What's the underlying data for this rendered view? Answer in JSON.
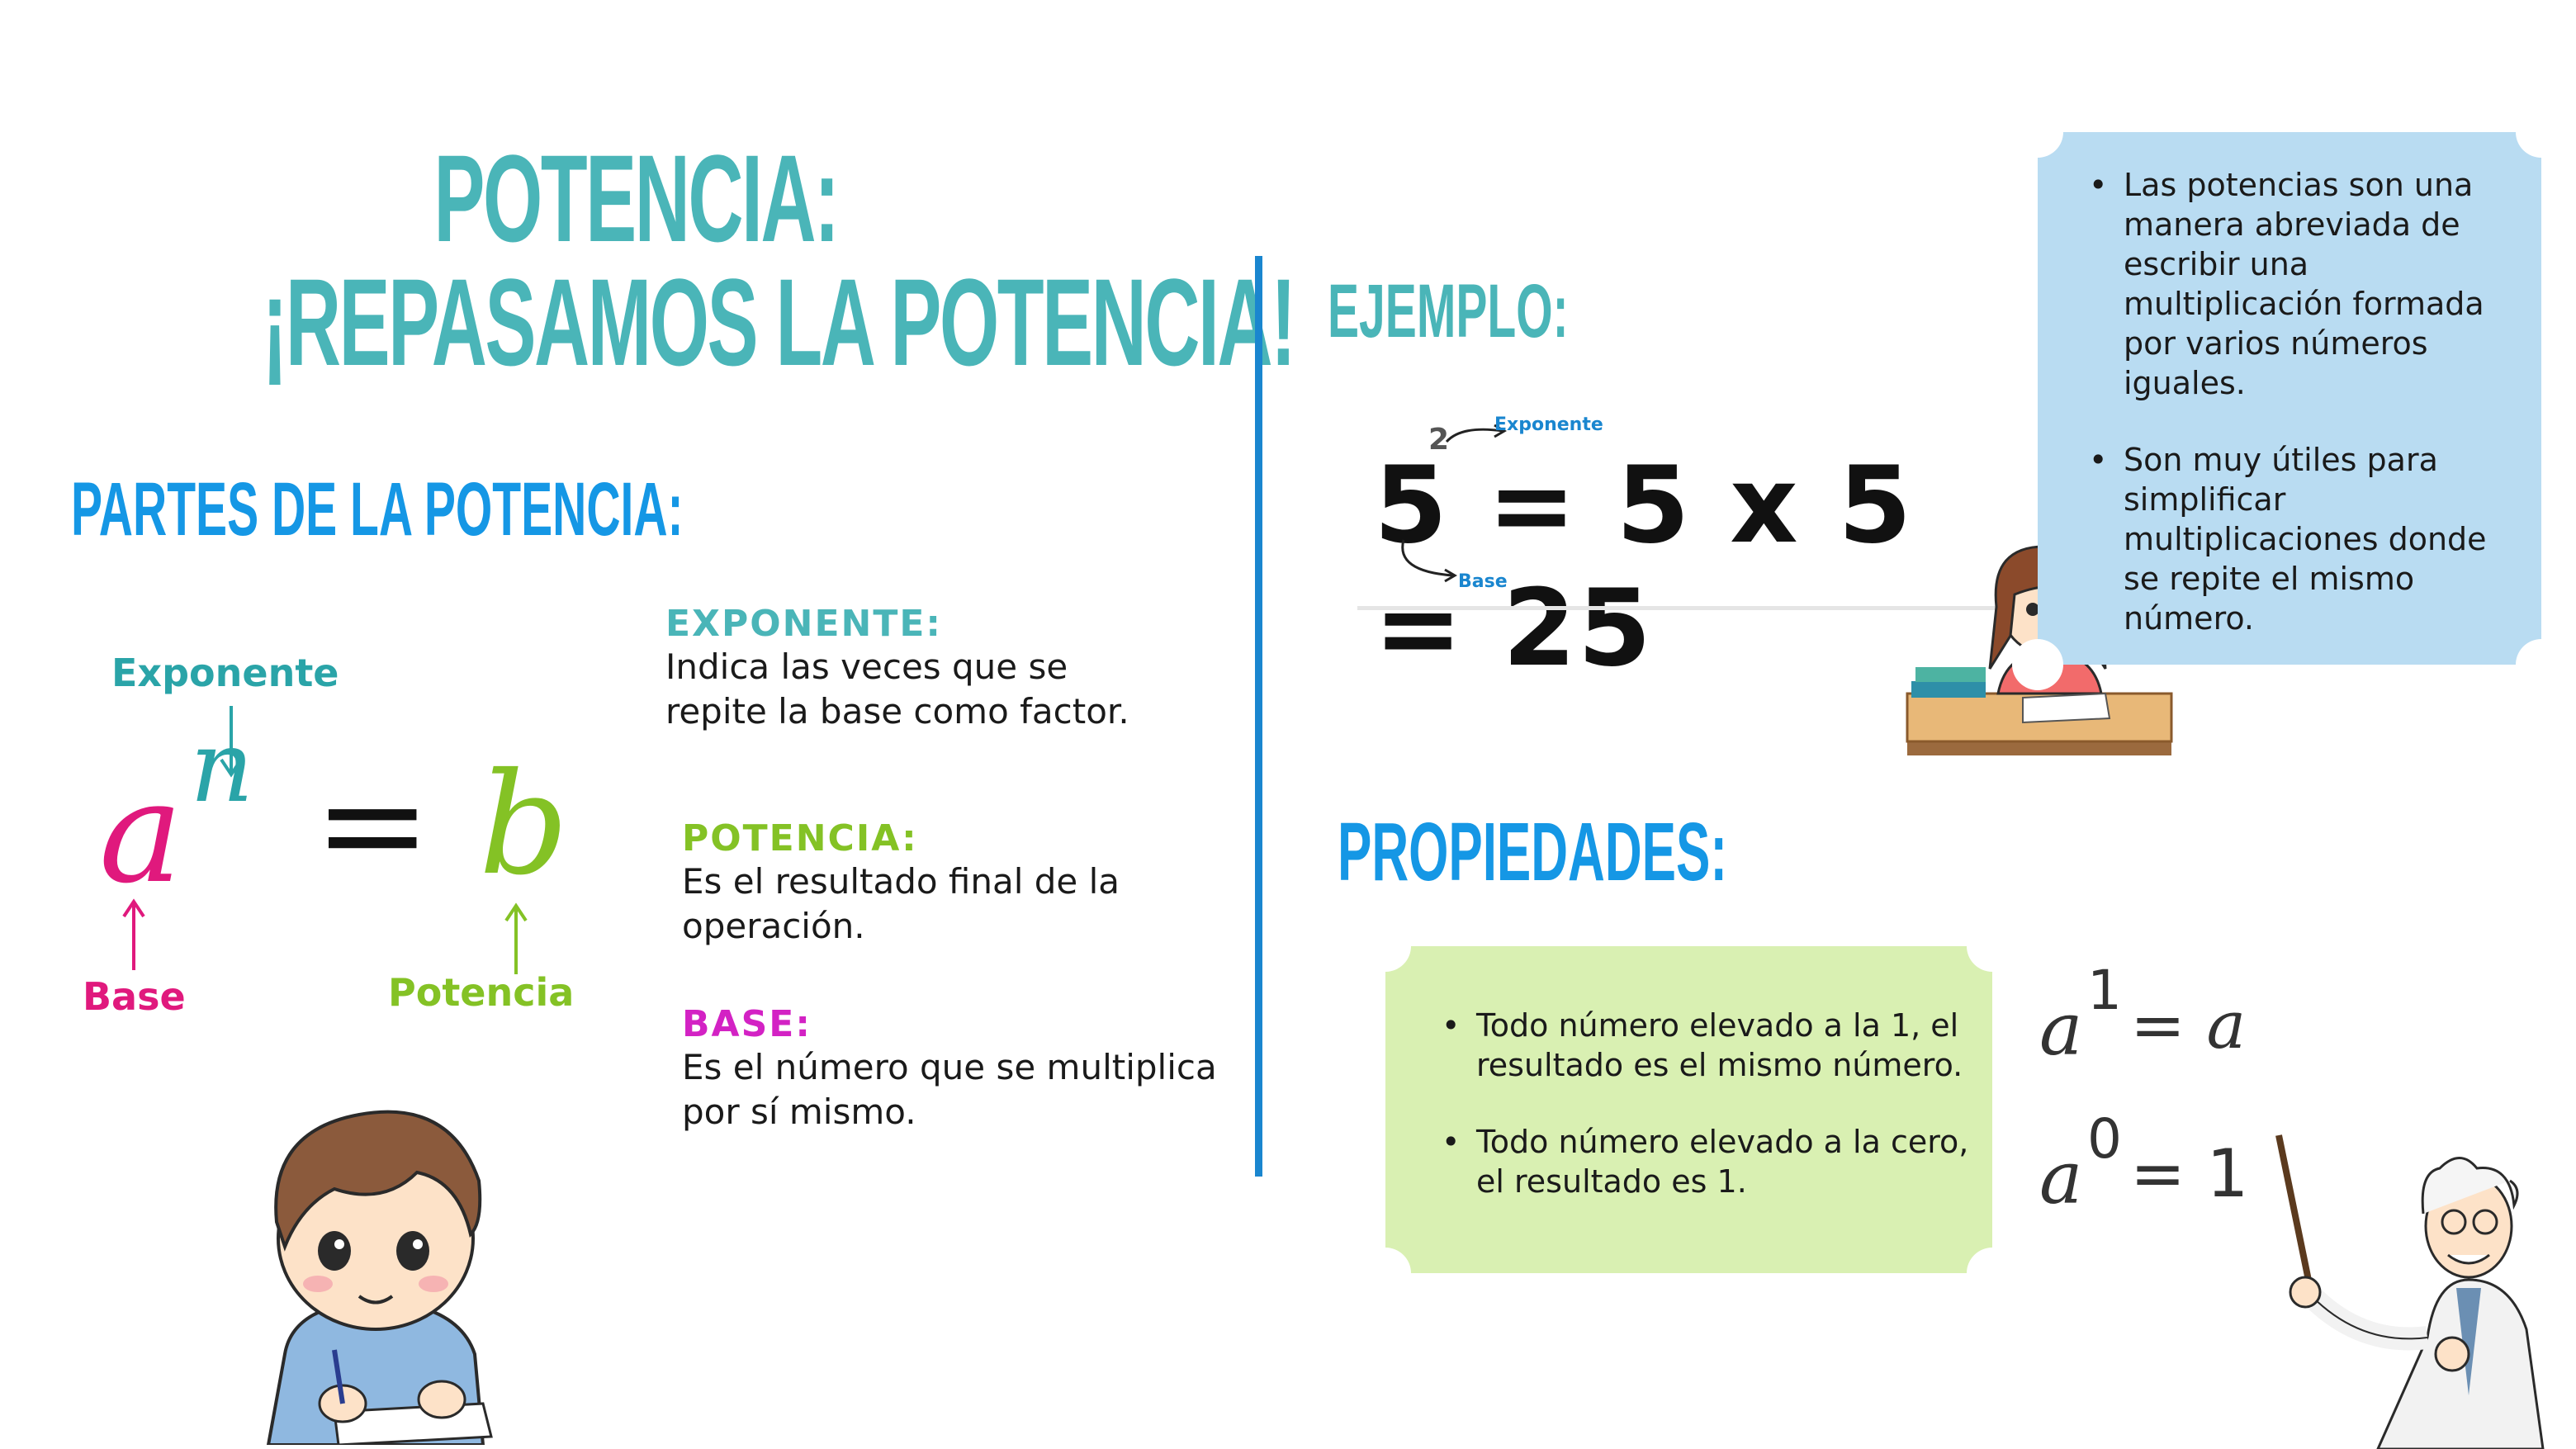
{
  "header": {
    "line1": "POTENCIA:",
    "line2": "¡REPASAMOS LA POTENCIA!"
  },
  "partes": {
    "heading": "PARTES DE LA POTENCIA:",
    "diagram": {
      "exponent_label": "Exponente",
      "base_label": "Base",
      "power_label": "Potencia",
      "base_symbol": "a",
      "exponent_symbol": "n",
      "equals": "=",
      "result_symbol": "b"
    },
    "definitions": [
      {
        "title": "EXPONENTE:",
        "text": "Indica las veces que se repite la base como factor.",
        "color": "#4ab5b8"
      },
      {
        "title": "POTENCIA:",
        "text": "Es el resultado final de la operación.",
        "color": "#84c225"
      },
      {
        "title": "BASE:",
        "text": "Es el número que se multiplica por sí mismo.",
        "color": "#d322c4"
      }
    ]
  },
  "ejemplo": {
    "heading": "EJEMPLO:",
    "formula": "5 = 5 x 5 = 25",
    "exponent": "2",
    "exponent_label": "Exponente",
    "base_label": "Base"
  },
  "info_box": {
    "bullets": [
      "Las potencias son una manera abreviada de escribir una multiplicación formada por varios números iguales.",
      "Son muy útiles para simplificar multiplicaciones donde se repite el mismo número."
    ]
  },
  "propiedades": {
    "heading": "PROPIEDADES:",
    "bullets": [
      "Todo número elevado a la 1, el resultado es el mismo número.",
      "Todo número elevado a la cero, el resultado es 1."
    ],
    "formulas": [
      {
        "base": "a",
        "exp": "1",
        "rhs": "= a"
      },
      {
        "base": "a",
        "exp": "0",
        "rhs": "= 1"
      }
    ]
  },
  "colors": {
    "teal": "#4ab5b8",
    "blue": "#1597e5",
    "green": "#84c225",
    "magenta": "#e0197d",
    "purple": "#d322c4",
    "light_blue_box": "#b9dcf2",
    "light_green_box": "#d9f0b2"
  },
  "icons": [
    "boy-writing-illustration",
    "girl-studying-illustration",
    "professor-pointer-illustration"
  ]
}
